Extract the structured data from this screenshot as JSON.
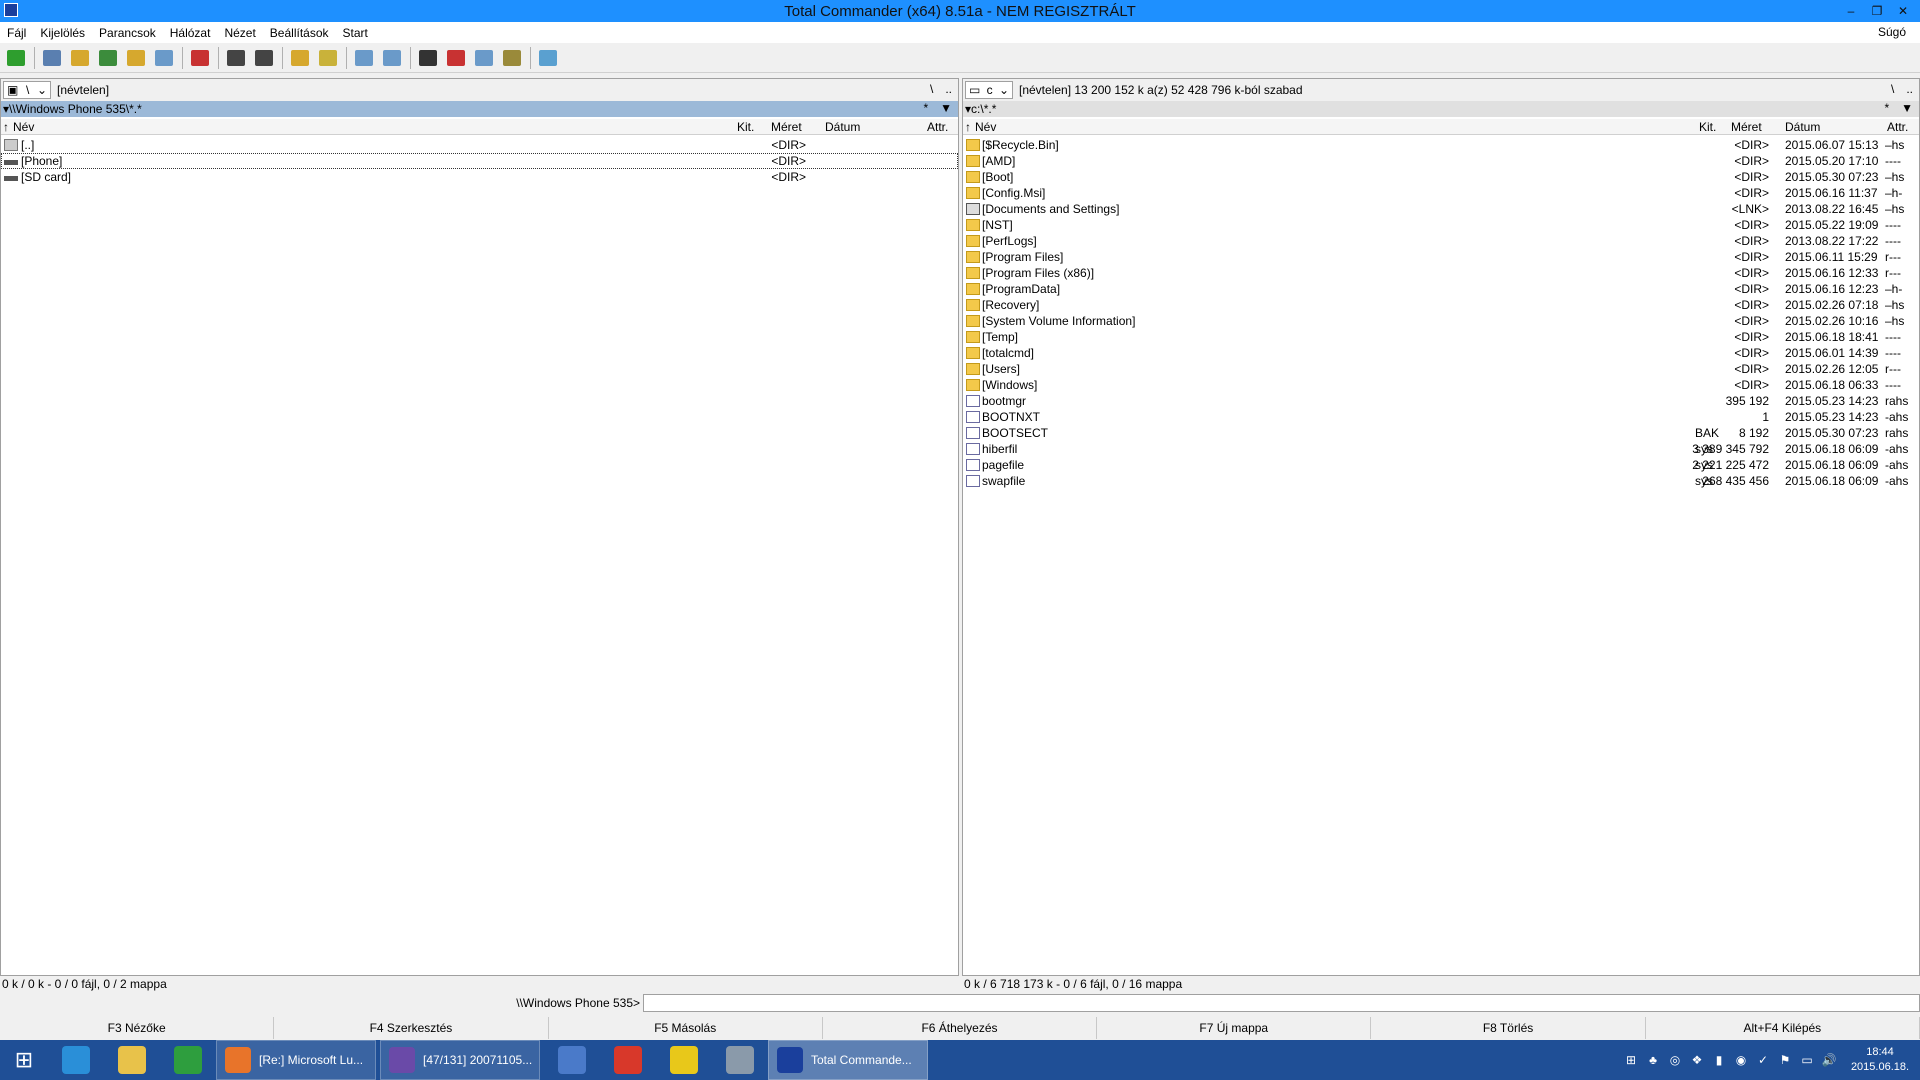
{
  "window": {
    "title": "Total Commander (x64) 8.51a - NEM REGISZTRÁLT"
  },
  "menu": {
    "items": [
      "Fájl",
      "Kijelölés",
      "Parancsok",
      "Hálózat",
      "Nézet",
      "Beállítások",
      "Start"
    ],
    "help": "Súgó"
  },
  "toolbar": {
    "buttons": [
      {
        "icon": "refresh-icon",
        "color": "#2e9e2e"
      },
      {
        "icon": "brief-view-icon",
        "color": "#5a7fb0"
      },
      {
        "icon": "tree-view-icon",
        "color": "#d6a82e"
      },
      {
        "icon": "thumbnail-icon",
        "color": "#3c8c3c"
      },
      {
        "icon": "branch-view-icon",
        "color": "#d6a82e"
      },
      {
        "icon": "sync-dirs-icon",
        "color": "#6a9ac9"
      },
      {
        "icon": "invert-selection-icon",
        "color": "#c83232"
      },
      {
        "icon": "back-icon",
        "color": "#444444"
      },
      {
        "icon": "forward-icon",
        "color": "#444444"
      },
      {
        "icon": "pack-icon",
        "color": "#d6a82e"
      },
      {
        "icon": "unpack-icon",
        "color": "#c9b23a"
      },
      {
        "icon": "ftp-icon",
        "color": "#6a9ac9"
      },
      {
        "icon": "url-icon",
        "color": "#6a9ac9"
      },
      {
        "icon": "find-icon",
        "color": "#333333"
      },
      {
        "icon": "rename-icon",
        "color": "#c83232"
      },
      {
        "icon": "compare-icon",
        "color": "#6a9ac9"
      },
      {
        "icon": "multi-rename-icon",
        "color": "#9a8a3a"
      },
      {
        "icon": "notepad-icon",
        "color": "#5aa0d0"
      }
    ]
  },
  "left_panel": {
    "drive": "\\",
    "drive_info": "[névtelen]",
    "root_btn": "\\",
    "up_btn": "..",
    "path": "\\\\Windows Phone 535\\*.*",
    "path_star": "*",
    "columns": {
      "name": "Név",
      "ext": "Kit.",
      "size": "Méret",
      "date": "Dátum",
      "attr": "Attr."
    },
    "rows": [
      {
        "name": "[..]",
        "ext": "",
        "size": "<DIR>",
        "date": "",
        "attr": "",
        "icon": "up"
      },
      {
        "name": "[Phone]",
        "ext": "",
        "size": "<DIR>",
        "date": "",
        "attr": "",
        "icon": "drive"
      },
      {
        "name": "[SD card]",
        "ext": "",
        "size": "<DIR>",
        "date": "",
        "attr": "",
        "icon": "drive"
      }
    ],
    "status": "0 k / 0 k - 0 / 0 fájl, 0 / 2 mappa"
  },
  "right_panel": {
    "drive": "c",
    "drive_info": "[névtelen]  13 200 152 k a(z) 52 428 796 k-ból szabad",
    "root_btn": "\\",
    "up_btn": "..",
    "path": "c:\\*.*",
    "path_star": "*",
    "columns": {
      "name": "Név",
      "ext": "Kit.",
      "size": "Méret",
      "date": "Dátum",
      "attr": "Attr."
    },
    "rows": [
      {
        "name": "[$Recycle.Bin]",
        "ext": "",
        "size": "<DIR>",
        "date": "2015.06.07 15:13",
        "attr": "–hs",
        "icon": "folder"
      },
      {
        "name": "[AMD]",
        "ext": "",
        "size": "<DIR>",
        "date": "2015.05.20 17:10",
        "attr": "----",
        "icon": "folder"
      },
      {
        "name": "[Boot]",
        "ext": "",
        "size": "<DIR>",
        "date": "2015.05.30 07:23",
        "attr": "–hs",
        "icon": "folder"
      },
      {
        "name": "[Config.Msi]",
        "ext": "",
        "size": "<DIR>",
        "date": "2015.06.16 11:37",
        "attr": "–h-",
        "icon": "folder"
      },
      {
        "name": "[Documents and Settings]",
        "ext": "",
        "size": "<LNK>",
        "date": "2013.08.22 16:45",
        "attr": "–hs",
        "icon": "link"
      },
      {
        "name": "[NST]",
        "ext": "",
        "size": "<DIR>",
        "date": "2015.05.22 19:09",
        "attr": "----",
        "icon": "folder"
      },
      {
        "name": "[PerfLogs]",
        "ext": "",
        "size": "<DIR>",
        "date": "2013.08.22 17:22",
        "attr": "----",
        "icon": "folder"
      },
      {
        "name": "[Program Files]",
        "ext": "",
        "size": "<DIR>",
        "date": "2015.06.11 15:29",
        "attr": "r---",
        "icon": "folder"
      },
      {
        "name": "[Program Files (x86)]",
        "ext": "",
        "size": "<DIR>",
        "date": "2015.06.16 12:33",
        "attr": "r---",
        "icon": "folder"
      },
      {
        "name": "[ProgramData]",
        "ext": "",
        "size": "<DIR>",
        "date": "2015.06.16 12:23",
        "attr": "–h-",
        "icon": "folder"
      },
      {
        "name": "[Recovery]",
        "ext": "",
        "size": "<DIR>",
        "date": "2015.02.26 07:18",
        "attr": "–hs",
        "icon": "folder"
      },
      {
        "name": "[System Volume Information]",
        "ext": "",
        "size": "<DIR>",
        "date": "2015.02.26 10:16",
        "attr": "–hs",
        "icon": "folder"
      },
      {
        "name": "[Temp]",
        "ext": "",
        "size": "<DIR>",
        "date": "2015.06.18 18:41",
        "attr": "----",
        "icon": "folder"
      },
      {
        "name": "[totalcmd]",
        "ext": "",
        "size": "<DIR>",
        "date": "2015.06.01 14:39",
        "attr": "----",
        "icon": "folder"
      },
      {
        "name": "[Users]",
        "ext": "",
        "size": "<DIR>",
        "date": "2015.02.26 12:05",
        "attr": "r---",
        "icon": "folder"
      },
      {
        "name": "[Windows]",
        "ext": "",
        "size": "<DIR>",
        "date": "2015.06.18 06:33",
        "attr": "----",
        "icon": "folder"
      },
      {
        "name": "bootmgr",
        "ext": "",
        "size": "395 192",
        "date": "2015.05.23 14:23",
        "attr": "rahs",
        "icon": "file"
      },
      {
        "name": "BOOTNXT",
        "ext": "",
        "size": "1",
        "date": "2015.05.23 14:23",
        "attr": "-ahs",
        "icon": "file"
      },
      {
        "name": "BOOTSECT",
        "ext": "BAK",
        "size": "8 192",
        "date": "2015.05.30 07:23",
        "attr": "rahs",
        "icon": "file"
      },
      {
        "name": "hiberfil",
        "ext": "sys",
        "size": "3 389 345 792",
        "date": "2015.06.18 06:09",
        "attr": "-ahs",
        "icon": "file"
      },
      {
        "name": "pagefile",
        "ext": "sys",
        "size": "2 221 225 472",
        "date": "2015.06.18 06:09",
        "attr": "-ahs",
        "icon": "file"
      },
      {
        "name": "swapfile",
        "ext": "sys",
        "size": "268 435 456",
        "date": "2015.06.18 06:09",
        "attr": "-ahs",
        "icon": "file"
      }
    ],
    "status": "0 k / 6 718 173 k - 0 / 6 fájl, 0 / 16 mappa"
  },
  "cmdline": {
    "prompt": "\\\\Windows Phone 535>",
    "value": ""
  },
  "fkeys": [
    "F3 Nézőke",
    "F4 Szerkesztés",
    "F5 Másolás",
    "F6 Áthelyezés",
    "F7 Új mappa",
    "F8 Törlés",
    "Alt+F4 Kilépés"
  ],
  "taskbar": {
    "pinned": [
      {
        "icon": "ie-icon",
        "color": "#2a8fd8"
      },
      {
        "icon": "explorer-icon",
        "color": "#e8c24a"
      },
      {
        "icon": "store-icon",
        "color": "#2e9e3e"
      }
    ],
    "windows": [
      {
        "label": "[Re:] Microsoft Lu...",
        "icon": "firefox-icon",
        "color": "#e8742a"
      },
      {
        "label": "[47/131] 20071105...",
        "icon": "irfanview-icon",
        "color": "#6a4aa8"
      }
    ],
    "pinned2": [
      {
        "icon": "network-icon",
        "color": "#4a7ac9"
      },
      {
        "icon": "music-icon",
        "color": "#d8382a"
      },
      {
        "icon": "clock-app-icon",
        "color": "#e8c81a"
      },
      {
        "icon": "calculator-icon",
        "color": "#8a9aaa"
      }
    ],
    "active": {
      "label": "Total Commande...",
      "icon": "totalcmd-icon",
      "color": "#1a3f9c"
    },
    "tray": [
      "⊞",
      "♣",
      "◎",
      "❖",
      "▮",
      "◉",
      "✓",
      "⚑",
      "▭",
      "🔊"
    ],
    "time": "18:44",
    "date": "2015.06.18."
  }
}
